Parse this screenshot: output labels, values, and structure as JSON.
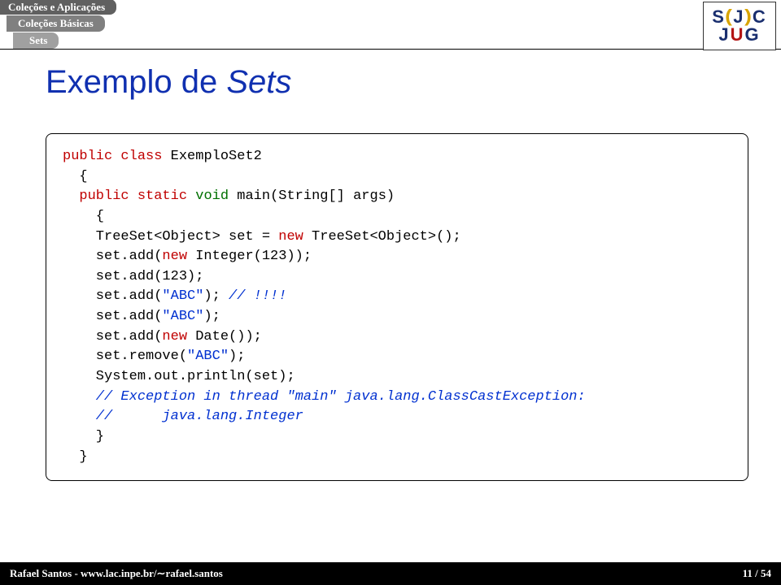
{
  "breadcrumb": {
    "l1": "Coleções e Aplicações",
    "l2": "Coleções Básicas",
    "l3": "Sets"
  },
  "logo": {
    "row1a": "S",
    "row1b": "J",
    "row1c": "C",
    "row2a": "J",
    "row2b": "U",
    "row2c": "G"
  },
  "title": {
    "prefix": "Exemplo de ",
    "ital": "Sets"
  },
  "code": {
    "l01a": "public",
    "l01b": " class",
    "l01c": " ExemploSet2",
    "l02": "  {",
    "l03a": "  public",
    "l03b": " static",
    "l03c": " void",
    "l03d": " main(String[] args)",
    "l04": "    {",
    "l05a": "    TreeSet<Object> set = ",
    "l05b": "new",
    "l05c": " TreeSet<Object>();",
    "l06a": "    set.add(",
    "l06b": "new",
    "l06c": " Integer(123));",
    "l07": "    set.add(123);",
    "l08a": "    set.add(",
    "l08b": "\"ABC\"",
    "l08c": "); ",
    "l08d": "// !!!!",
    "l09a": "    set.add(",
    "l09b": "\"ABC\"",
    "l09c": ");",
    "l10a": "    set.add(",
    "l10b": "new",
    "l10c": " Date());",
    "l11a": "    set.remove(",
    "l11b": "\"ABC\"",
    "l11c": ");",
    "l12": "    System.out.println(set);",
    "l13": "    // Exception in thread \"main\" java.lang.ClassCastException:",
    "l14": "    //      java.lang.Integer",
    "l15": "    }",
    "l16": "  }"
  },
  "footer": {
    "author": "Rafael Santos - www.lac.inpe.br/∼rafael.santos",
    "page": "11 / 54"
  }
}
